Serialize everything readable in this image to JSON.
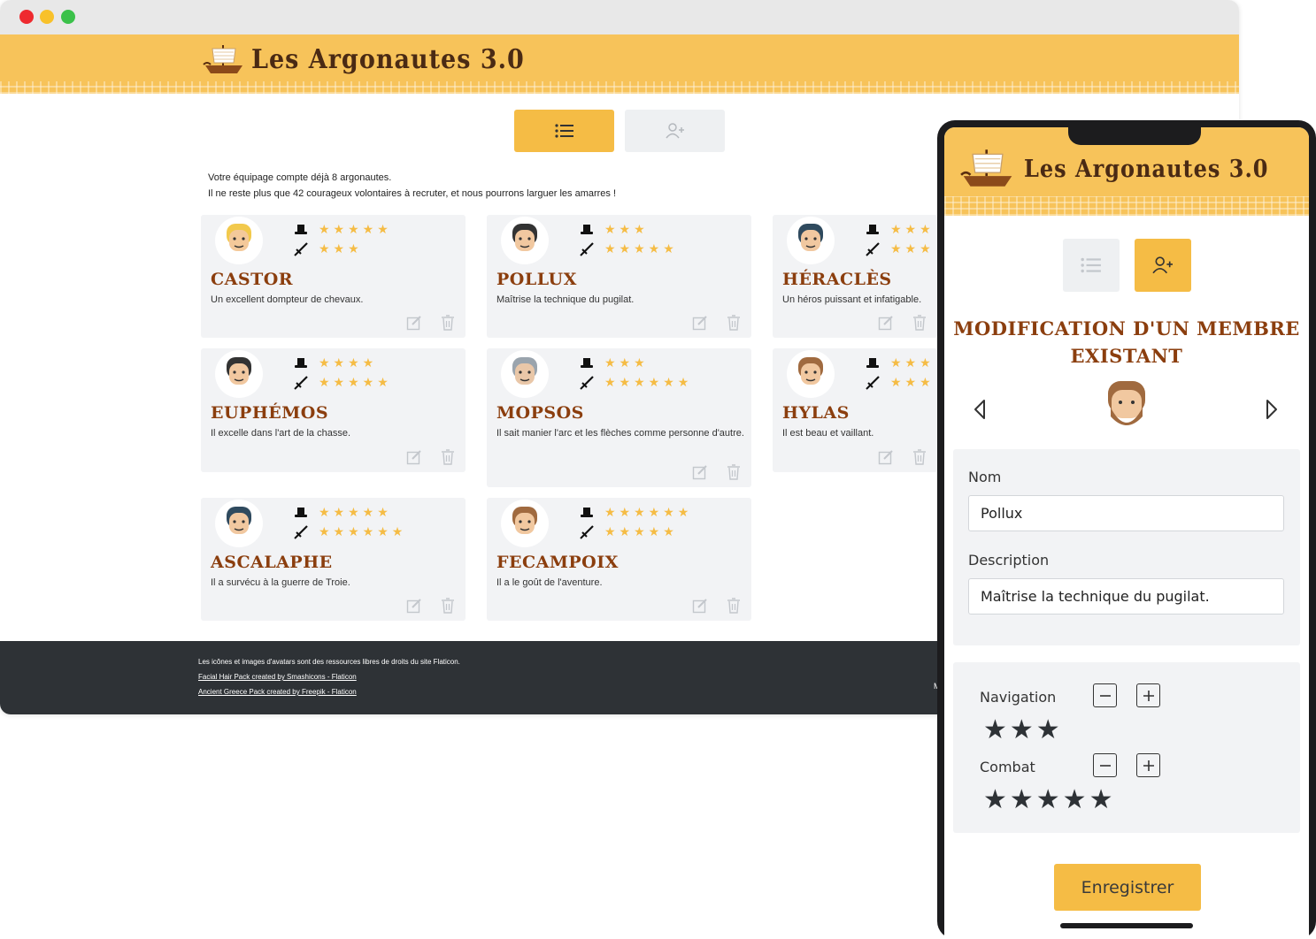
{
  "app": {
    "title": "Les Argonautes 3.0"
  },
  "intro": {
    "line1": "Votre équipage compte déjà 8 argonautes.",
    "line2": "Il ne reste plus que 42 courageux volontaires à recruter, et nous pourrons larguer les amarres !"
  },
  "crew": [
    {
      "name": "Castor",
      "description": "Un excellent dompteur de chevaux.",
      "navigation": "★★★★★",
      "combat": "★★★",
      "navigation_rating": 5,
      "combat_rating": 3
    },
    {
      "name": "Pollux",
      "description": "Maîtrise la technique du pugilat.",
      "navigation": "★★★",
      "combat": "★★★★★",
      "navigation_rating": 3,
      "combat_rating": 5
    },
    {
      "name": "Héraclès",
      "description": "Un héros puissant et infatigable.",
      "navigation": "★★★",
      "combat": "★★★",
      "navigation_rating": 3,
      "combat_rating": 3
    },
    {
      "name": "Euphémos",
      "description": "Il excelle dans l'art de la chasse.",
      "navigation": "★★★★",
      "combat": "★★★★★",
      "navigation_rating": 4,
      "combat_rating": 5
    },
    {
      "name": "Mopsos",
      "description": "Il sait manier l'arc et les flèches comme personne d'autre.",
      "navigation": "★★★",
      "combat": "★★★★★★",
      "navigation_rating": 3,
      "combat_rating": 6
    },
    {
      "name": "Hylas",
      "description": "Il est beau et vaillant.",
      "navigation": "★★★",
      "combat": "★★★",
      "navigation_rating": 3,
      "combat_rating": 3
    },
    {
      "name": "Ascalaphe",
      "description": "Il a survécu à la guerre de Troie.",
      "navigation": "★★★★★",
      "combat": "★★★★★★",
      "navigation_rating": 5,
      "combat_rating": 6
    },
    {
      "name": "Fecampoix",
      "description": "Il a le goût de l'aventure.",
      "navigation": "★★★★★★",
      "combat": "★★★★★",
      "navigation_rating": 6,
      "combat_rating": 5
    }
  ],
  "footer": {
    "credits": "Les icônes et images d'avatars sont des ressources libres de droits du site Flaticon.",
    "link1": "Facial Hair Pack created by Smashicons - Flaticon",
    "link2": "Ancient Greece Pack created by Freepik - Flaticon",
    "cut_text": "M"
  },
  "mobile": {
    "title": "Modification d'un membre existant",
    "form": {
      "name_label": "Nom",
      "name_value": "Pollux",
      "description_label": "Description",
      "description_value": "Maîtrise la technique du pugilat."
    },
    "stats": {
      "navigation_label": "Navigation",
      "navigation_stars": "★★★",
      "navigation_rating": 3,
      "combat_label": "Combat",
      "combat_stars": "★★★★★",
      "combat_rating": 5
    },
    "save_label": "Enregistrer"
  },
  "colors": {
    "banner": "#f7c35a",
    "accent": "#f5bc45",
    "name": "#8b3e0e",
    "card": "#f2f3f5",
    "footer": "#2e3236"
  },
  "icons": {
    "logo": "ship-icon",
    "navigation": "hat-icon",
    "combat": "sword-icon",
    "edit": "edit-icon",
    "delete": "trash-icon",
    "list": "list-icon",
    "add": "add-user-icon",
    "prev": "chevron-left-icon",
    "next": "chevron-right-icon"
  }
}
